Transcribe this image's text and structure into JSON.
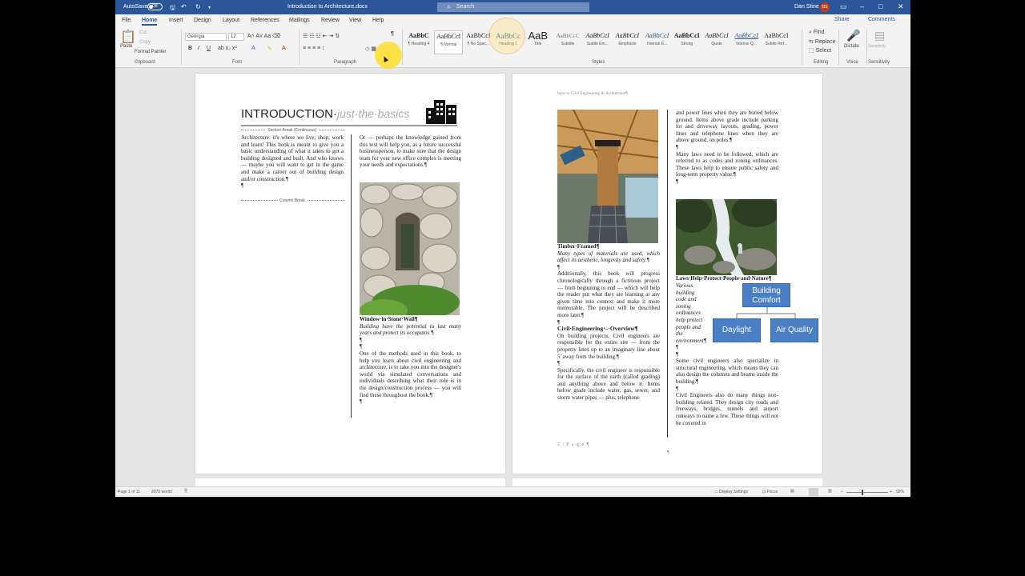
{
  "titlebar": {
    "autosave": "AutoSave",
    "toggle": "Off",
    "doc_title": "Introduction to Architecture.docx",
    "search": "Search",
    "user": "Dan Stine",
    "initials": "DS"
  },
  "menu": {
    "tabs": [
      "File",
      "Home",
      "Insert",
      "Design",
      "Layout",
      "References",
      "Mailings",
      "Review",
      "View",
      "Help"
    ],
    "share": "Share",
    "comments": "Comments"
  },
  "ribbon": {
    "clipboard": {
      "paste": "Paste",
      "cut": "Cut",
      "copy": "Copy",
      "format_painter": "Format Painter",
      "label": "Clipboard"
    },
    "font": {
      "name": "Georgia",
      "size": "12",
      "label": "Font"
    },
    "paragraph": {
      "label": "Paragraph"
    },
    "styles": {
      "label": "Styles",
      "items": [
        {
          "preview": "AaBbC",
          "name": "¶ Heading 4"
        },
        {
          "preview": "AaBbCcI",
          "name": "¶ Normal"
        },
        {
          "preview": "AaBbCcI",
          "name": "¶ No Spac..."
        },
        {
          "preview": "AaBbCc",
          "name": "Heading 1"
        },
        {
          "preview": "AaB",
          "name": "Title"
        },
        {
          "preview": "AaBbCcC",
          "name": "Subtitle"
        },
        {
          "preview": "AaBbCcI",
          "name": "Subtle Em..."
        },
        {
          "preview": "AaBbCcI",
          "name": "Emphasis"
        },
        {
          "preview": "AaBbCcI",
          "name": "Intense E..."
        },
        {
          "preview": "AaBbCcI",
          "name": "Strong"
        },
        {
          "preview": "AaBbCcI",
          "name": "Quote"
        },
        {
          "preview": "AaBbCcI",
          "name": "Intense Q..."
        },
        {
          "preview": "AaBbCcI",
          "name": "Subtle Ref..."
        }
      ]
    },
    "editing": {
      "find": "Find",
      "replace": "Replace",
      "select": "Select",
      "label": "Editing"
    },
    "voice": {
      "dictate": "Dictate",
      "label": "Voice"
    },
    "sensitivity": {
      "btn": "Sensitivity",
      "label": "Sensitivity"
    }
  },
  "page1": {
    "title_main": "INTRODUCTION·",
    "title_sub": "just·the·basics",
    "section_break": "Section Break (Continuous)",
    "column_break": "Column Break",
    "left_text": "Architecture: it's where we live, shop, work and learn! This book is meant to give you a basic understanding of what it takes to get a building designed and built. And who knows — maybe you will want to get in the game and make a career out of building design and/or construction.¶",
    "right_intro": "Or — perhaps the knowledge gained from this text will help you, as a future successful businessperson, to make sure that the design team for your new office complex is meeting your needs and expectations.¶",
    "img1_caption": "Window·in·Stone·Wall¶",
    "img1_desc": "Building have the potential to last many years and protect its occupants.¶",
    "right_body": "One of the methods used in this book, to help you learn about civil engineering and architecture, is to take you into the designer's world via simulated conversations and individuals describing what their role is in the design/construction process — you will find these throughout the book.¶"
  },
  "page2": {
    "header": "Intro·to·Civil·Engineering·&·Architecture¶",
    "img_caption": "Timber·Framed¶",
    "img_desc": "Many types of materials are used, which affect its aesthetic, longevity and safety.¶",
    "left_p1": "Additionally, this book will progress chronologically through a fictitious project — from beginning to end — which will help the reader put what they are learning at any given time into context and make it more memorable. The project will be described more later.¶",
    "heading": "Civil·Engineering·–·Overview¶",
    "left_p2": "On building projects, Civil engineers are responsible for the entire site — from the property lines up to an imaginary line about 5' away from the building.¶",
    "left_p3": "Specifically, the civil engineer is responsible for the surface of the earth (called grading) and anything above and below it. Items below grade include water, gas, sewer, and storm water pipes — plus, telephone",
    "right_p1": "and power lines when they are buried below ground. Items above grade include parking lot and driveway layouts, grading, power lines and telephone lines when they are above ground, on poles.¶",
    "right_p2": "Many laws need to be followed, which are referred to as codes and zoning ordinances. These laws help to ensure public safety and long-term property value.¶",
    "img2_caption": "Laws·Help·Protect·People·and·Nature¶",
    "img2_desc": "Various building code and zoning ordinances help protect people and the environment¶",
    "smart_top": "Building Comfort",
    "smart_left": "Daylight",
    "smart_right": "Air Quality",
    "right_p3": "Some civil engineers also specialize in structural engineering, which means they can also design the columns and beams inside the building.¶",
    "right_p4": "Civil Engineers also do many things non-building related. They design city roads and freeways, bridges, tunnels and airport runways to name a few. These things will not be covered in",
    "footer": "2 | P a g e ¶"
  },
  "status": {
    "page": "Page 1 of 11",
    "words": "2970 words",
    "display": "Display Settings",
    "focus": "Focus",
    "zoom": "92%"
  }
}
